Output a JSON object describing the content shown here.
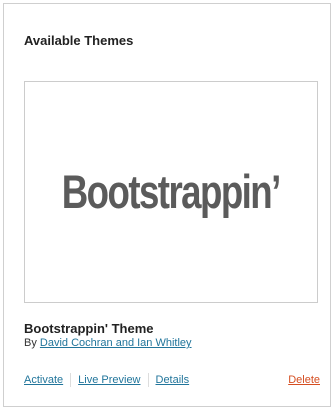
{
  "panel": {
    "title": "Available Themes"
  },
  "theme": {
    "screenshot_text": "Bootstrappin’",
    "name": "Bootstrappin' Theme",
    "by_label": "By",
    "author": "David Cochran and Ian Whitley"
  },
  "actions": {
    "activate": "Activate",
    "live_preview": "Live Preview",
    "details": "Details",
    "delete": "Delete"
  },
  "colors": {
    "link": "#21759b",
    "delete": "#d54e21",
    "border": "#cfcfcf"
  }
}
